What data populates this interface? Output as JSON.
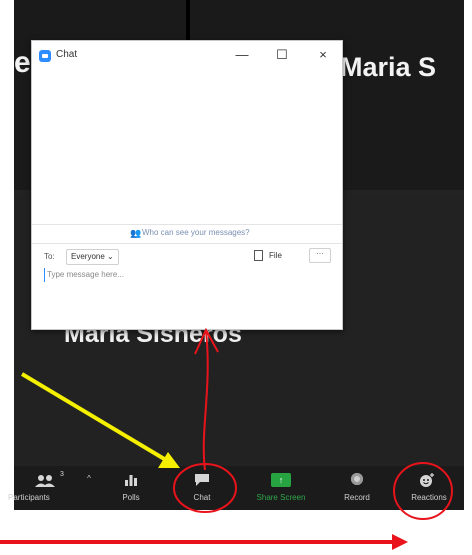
{
  "meeting": {
    "participants": {
      "left_partial": "e",
      "right": "Maria S",
      "bottom": "Maria Sisheros"
    }
  },
  "chat_window": {
    "title": "Chat",
    "icons": [
      "zoom-logo-icon",
      "minimize-icon",
      "maximize-icon",
      "close-icon"
    ],
    "minimize_glyph": "—",
    "maximize_glyph": "☐",
    "close_glyph": "×",
    "privacy_notice": "Who can see your messages?",
    "to_label": "To:",
    "recipient": "Everyone",
    "recipient_caret": "⌄",
    "file_label": "File",
    "more_glyph": "···",
    "message_placeholder": "Type message here..."
  },
  "toolbar": {
    "items": [
      {
        "label": "Participants",
        "icon": "participants-icon",
        "count": "3"
      },
      {
        "label": "Polls",
        "icon": "polls-icon"
      },
      {
        "label": "Chat",
        "icon": "chat-icon"
      },
      {
        "label": "Share Screen",
        "icon": "share-screen-icon"
      },
      {
        "label": "Record",
        "icon": "record-icon"
      },
      {
        "label": "Reactions",
        "icon": "reactions-icon"
      }
    ],
    "caret_glyph": "^",
    "share_glyph": "↑"
  },
  "annotation_colors": {
    "red": "#e8131b",
    "yellow": "#f4f000"
  }
}
